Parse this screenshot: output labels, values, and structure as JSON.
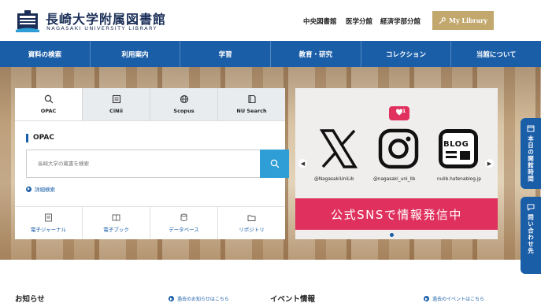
{
  "header": {
    "title": "長崎大学附属図書館",
    "subtitle": "NAGASAKI UNIVERSITY LIBRARY",
    "branches": [
      "中央図書館",
      "医学分館",
      "経済学部分館"
    ],
    "my_library": "My Library"
  },
  "nav": {
    "items": [
      "資料の検索",
      "利用案内",
      "学習",
      "教育・研究",
      "コレクション",
      "当館について"
    ]
  },
  "search": {
    "tabs": [
      "OPAC",
      "CiNii",
      "Scopus",
      "NU Search"
    ],
    "heading": "OPAC",
    "placeholder": "長崎大学の蔵書を検索",
    "advanced": "詳細検索",
    "resources": [
      "電子ジャーナル",
      "電子ブック",
      "データベース",
      "リポジトリ"
    ]
  },
  "banner": {
    "x_handle": "@NagasakiUniLib",
    "ig_handle": "@nagasaki_uni_lib",
    "blog_label": "BLOG",
    "blog_handle": "nulib.hatenablog.jp",
    "notify_count": "1",
    "strip_text": "公式SNSで情報発信中"
  },
  "side": {
    "hours": "本日の開館時間",
    "contact": "問い合わせ先"
  },
  "bottom": {
    "news_title": "お知らせ",
    "news_past": "過去のお知らせはこちら",
    "events_title": "イベント情報",
    "events_past": "過去のイベントはこちら"
  },
  "colors": {
    "primary": "#1a5ea8",
    "accent_gold": "#c3a86e",
    "sns_pink": "#e0315e",
    "search_blue": "#2f9ed6"
  }
}
